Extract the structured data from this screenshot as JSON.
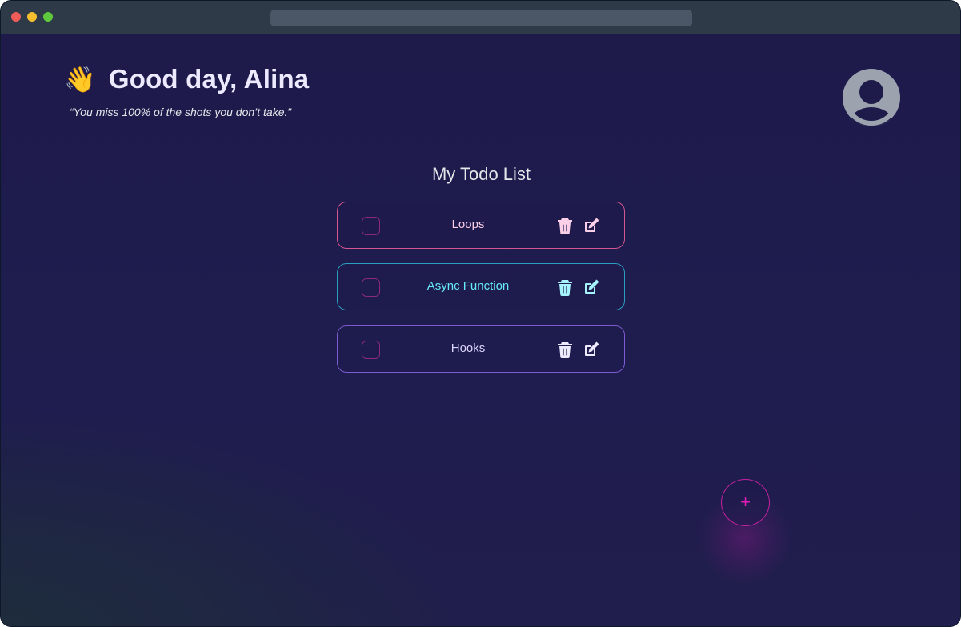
{
  "header": {
    "wave_emoji": "👋",
    "greeting": "Good day, Alina",
    "quote": "“You miss 100% of the shots you don’t take.”"
  },
  "list": {
    "title": "My Todo List",
    "items": [
      {
        "label": "Loops",
        "checked": false,
        "accent": "#d5558f"
      },
      {
        "label": "Async Function",
        "checked": false,
        "accent": "#2b9fbf"
      },
      {
        "label": "Hooks",
        "checked": false,
        "accent": "#7c5cd0"
      }
    ]
  },
  "fab": {
    "label": "+"
  },
  "icons": {
    "avatar": "user-avatar-icon",
    "delete": "trash-icon",
    "edit": "edit-pencil-icon",
    "add": "plus-icon"
  },
  "colors": {
    "background": "#1e1b4b",
    "fab_accent": "#e11db8",
    "checkbox_border": "#8b2a7a"
  }
}
